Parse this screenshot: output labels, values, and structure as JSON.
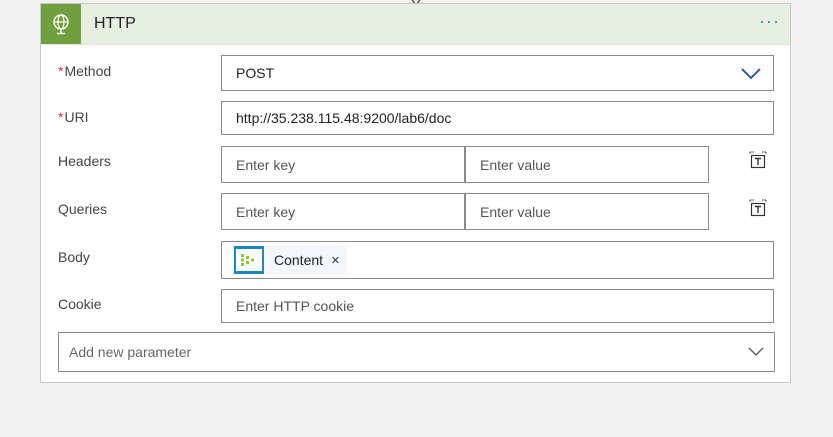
{
  "card": {
    "title": "HTTP",
    "menu_label": "···",
    "icon": "globe-icon",
    "accent_color": "#70a03e"
  },
  "fields": {
    "method": {
      "label": "Method",
      "required": true,
      "value": "POST"
    },
    "uri": {
      "label": "URI",
      "required": true,
      "value": "http://35.238.115.48:9200/lab6/doc"
    },
    "headers": {
      "label": "Headers",
      "key_placeholder": "Enter key",
      "value_placeholder": "Enter value"
    },
    "queries": {
      "label": "Queries",
      "key_placeholder": "Enter key",
      "value_placeholder": "Enter value"
    },
    "body": {
      "label": "Body",
      "token_label": "Content",
      "token_close": "×"
    },
    "cookie": {
      "label": "Cookie",
      "placeholder": "Enter HTTP cookie"
    }
  },
  "add_parameter": {
    "placeholder": "Add new parameter"
  },
  "required_marker": "*"
}
